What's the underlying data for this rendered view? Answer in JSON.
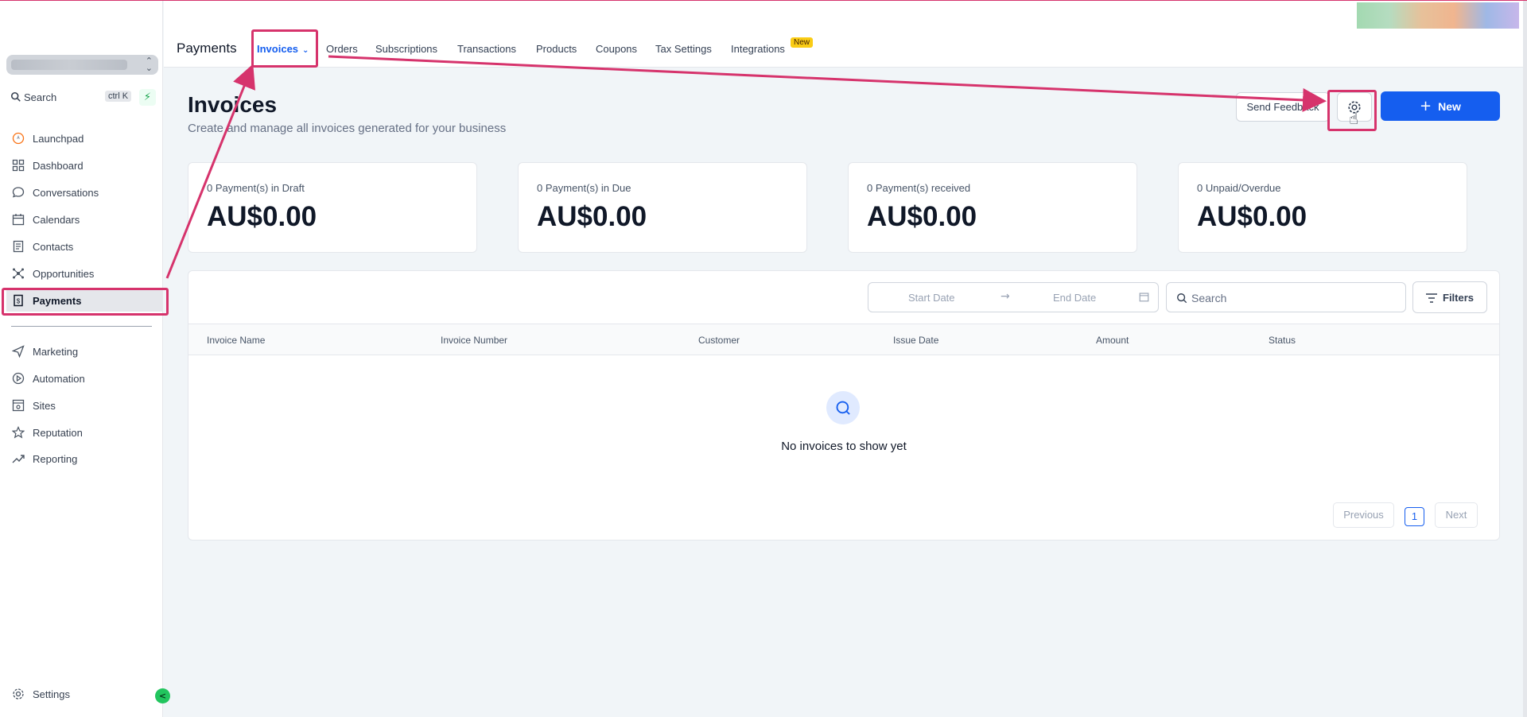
{
  "colors": {
    "accent": "#155eef",
    "annotation": "#d6336c",
    "badge": "#facc15",
    "sidebar_toggle": "#22c55e"
  },
  "sidebar": {
    "search_label": "Search",
    "search_shortcut": "ctrl K",
    "items": [
      {
        "label": "Launchpad",
        "icon": "launchpad-icon"
      },
      {
        "label": "Dashboard",
        "icon": "dashboard-icon"
      },
      {
        "label": "Conversations",
        "icon": "chat-icon"
      },
      {
        "label": "Calendars",
        "icon": "calendar-icon"
      },
      {
        "label": "Contacts",
        "icon": "contacts-icon"
      },
      {
        "label": "Opportunities",
        "icon": "opportunities-icon"
      },
      {
        "label": "Payments",
        "icon": "payments-icon",
        "active": true
      },
      {
        "label": "Marketing",
        "icon": "send-icon"
      },
      {
        "label": "Automation",
        "icon": "automation-icon"
      },
      {
        "label": "Sites",
        "icon": "sites-icon"
      },
      {
        "label": "Reputation",
        "icon": "star-icon"
      },
      {
        "label": "Reporting",
        "icon": "trend-icon"
      }
    ],
    "settings_label": "Settings"
  },
  "header": {
    "app_title": "Payments",
    "tabs": [
      {
        "label": "Invoices",
        "active": true
      },
      {
        "label": "Orders"
      },
      {
        "label": "Subscriptions"
      },
      {
        "label": "Transactions"
      },
      {
        "label": "Products"
      },
      {
        "label": "Coupons"
      },
      {
        "label": "Tax Settings"
      },
      {
        "label": "Integrations",
        "badge": "New"
      }
    ]
  },
  "page": {
    "title": "Invoices",
    "subtitle": "Create and manage all invoices generated for your business",
    "feedback_label": "Send Feedback",
    "new_label": "New"
  },
  "stats": [
    {
      "label": "0 Payment(s) in Draft",
      "value": "AU$0.00"
    },
    {
      "label": "0 Payment(s) in Due",
      "value": "AU$0.00"
    },
    {
      "label": "0 Payment(s) received",
      "value": "AU$0.00"
    },
    {
      "label": "0 Unpaid/Overdue",
      "value": "AU$0.00"
    }
  ],
  "table": {
    "start_date_placeholder": "Start Date",
    "end_date_placeholder": "End Date",
    "search_placeholder": "Search",
    "filters_label": "Filters",
    "columns": [
      "Invoice Name",
      "Invoice Number",
      "Customer",
      "Issue Date",
      "Amount",
      "Status"
    ],
    "rows": [],
    "empty_message": "No invoices to show yet",
    "pagination": {
      "previous": "Previous",
      "current_page": "1",
      "next": "Next"
    }
  }
}
